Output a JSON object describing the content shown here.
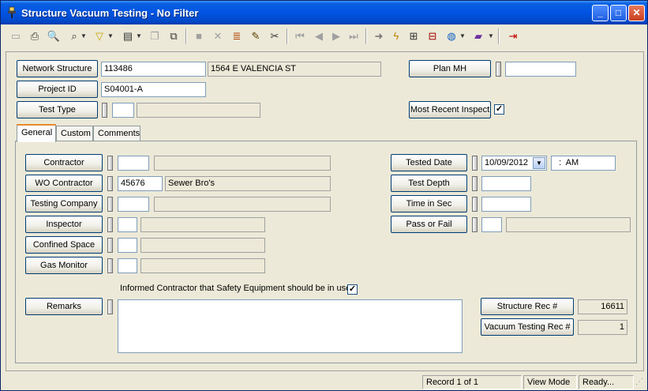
{
  "window": {
    "title": "Structure Vacuum Testing - No Filter"
  },
  "title_controls": {
    "minimize": "_",
    "maximize": "□",
    "close": "✕"
  },
  "header": {
    "network_structure_label": "Network Structure",
    "network_structure_id": "113486",
    "network_structure_address": "1564  E  VALENCIA ST",
    "project_id_label": "Project ID",
    "project_id": "S04001-A",
    "test_type_label": "Test Type",
    "test_type_code": "",
    "test_type_desc": "",
    "plan_mh_label": "Plan MH",
    "plan_mh_value": "",
    "most_recent_label": "Most Recent Inspect",
    "most_recent_checked": "✓"
  },
  "tabs": [
    {
      "label": "General"
    },
    {
      "label": "Custom"
    },
    {
      "label": "Comments"
    }
  ],
  "general": {
    "contractor_label": "Contractor",
    "contractor_code": "",
    "contractor_desc": "",
    "wo_contractor_label": "WO Contractor",
    "wo_contractor_code": "45676",
    "wo_contractor_desc": "Sewer Bro's",
    "testing_company_label": "Testing Company",
    "testing_company_code": "",
    "testing_company_desc": "",
    "inspector_label": "Inspector",
    "inspector_code": "",
    "inspector_desc": "",
    "confined_space_label": "Confined Space",
    "confined_space_code": "",
    "confined_space_desc": "",
    "gas_monitor_label": "Gas Monitor",
    "gas_monitor_code": "",
    "gas_monitor_desc": "",
    "safety_text": "Informed Contractor that Safety Equipment should be in use",
    "safety_checked": "✓",
    "remarks_label": "Remarks",
    "remarks_value": "",
    "tested_date_label": "Tested Date",
    "tested_date_value": "10/09/2012",
    "tested_time_value": "  :  AM",
    "test_depth_label": "Test Depth",
    "test_depth_value": "",
    "time_in_sec_label": "Time in Sec",
    "time_in_sec_value": "",
    "pass_fail_label": "Pass or Fail",
    "pass_fail_code": "",
    "pass_fail_desc": "",
    "structure_rec_label": "Structure Rec #",
    "structure_rec_value": "16611",
    "vacuum_rec_label": "Vacuum Testing Rec #",
    "vacuum_rec_value": "1"
  },
  "status": {
    "record": "Record 1 of 1",
    "mode": "View Mode",
    "state": "Ready..."
  },
  "colors": {
    "title_bar": "#0054e3",
    "window_bg": "#ece9d8",
    "tab_accent": "#e68b2c"
  }
}
